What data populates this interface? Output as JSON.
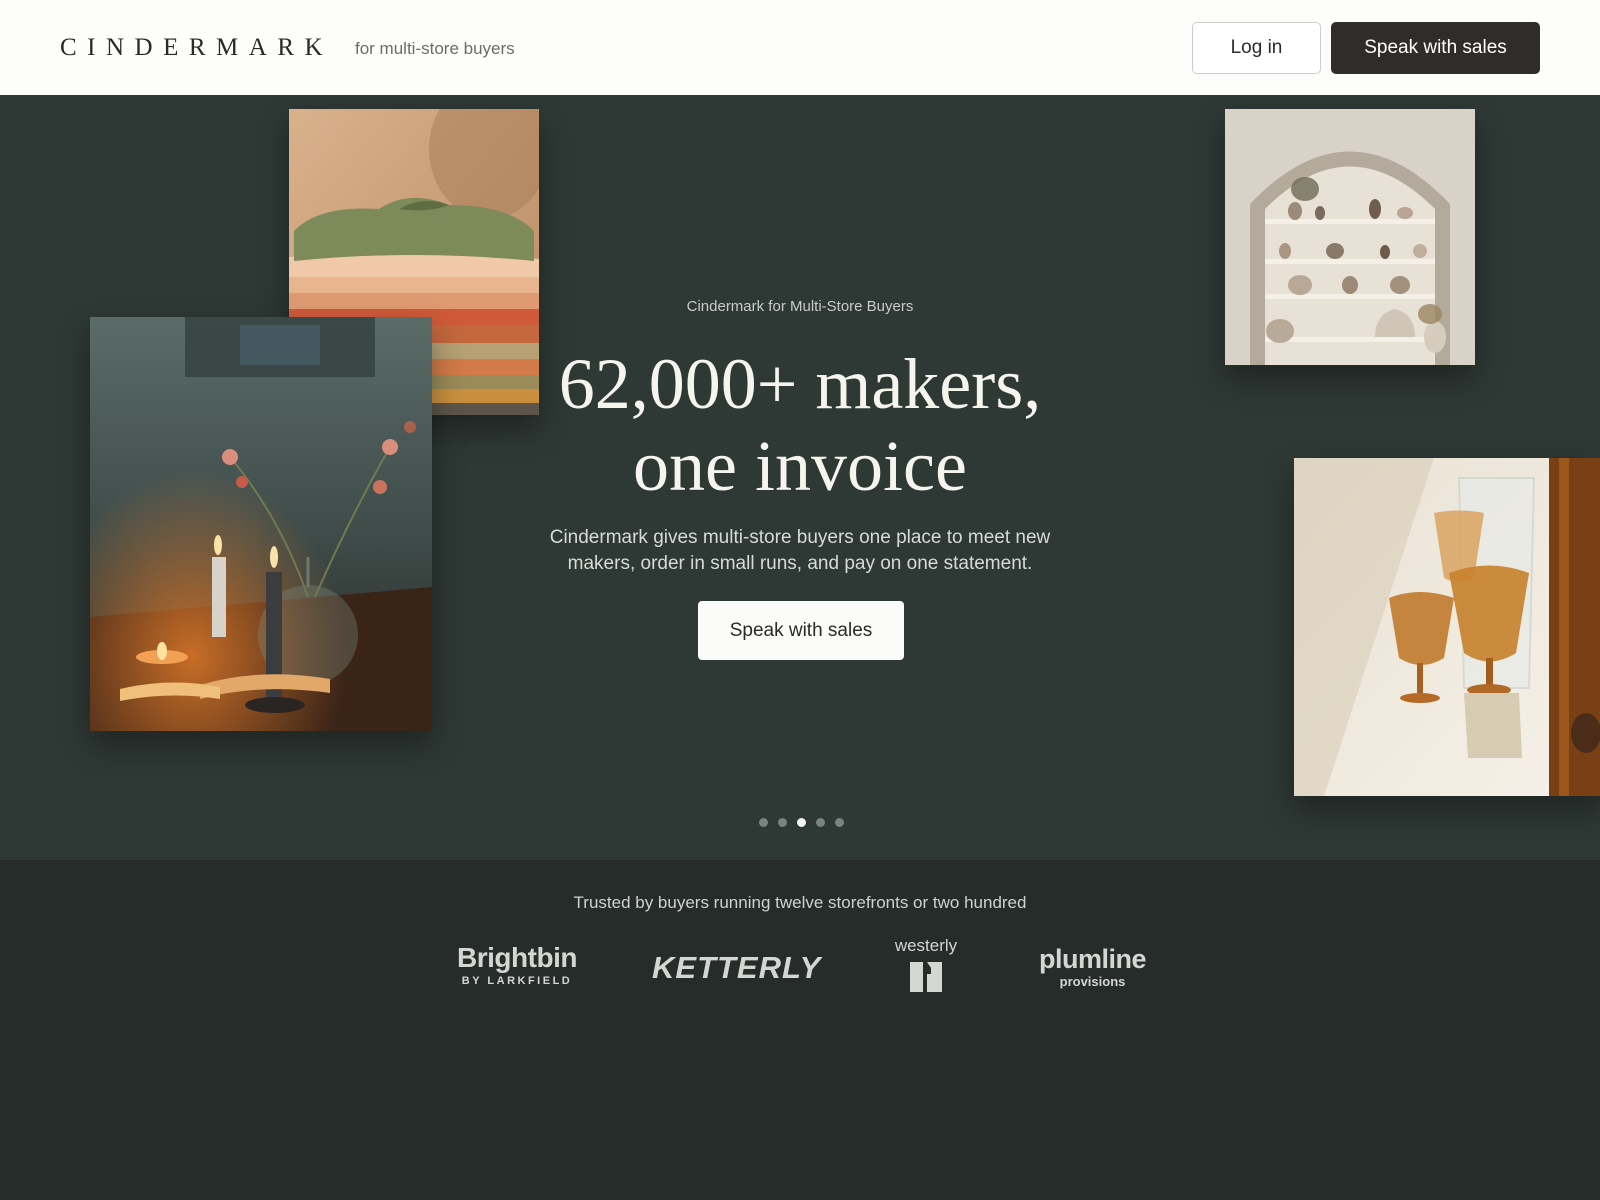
{
  "header": {
    "logo": "CINDERMARK",
    "tagline": "for multi-store buyers",
    "login_label": "Log in",
    "sales_label": "Speak with sales"
  },
  "hero": {
    "eyebrow": "Cindermark for Multi-Store Buyers",
    "headline_line1": "62,000+ makers,",
    "headline_line2": "one invoice",
    "subcopy": "Cindermark gives multi-store buyers one place to meet new makers, order in small runs, and pay on one statement.",
    "cta_label": "Speak with sales",
    "carousel": {
      "total": 5,
      "active_index": 2
    }
  },
  "trusted": {
    "caption": "Trusted by buyers running twelve storefronts or two hundred",
    "logos": [
      {
        "main": "Brightbin",
        "sub": "BY LARKFIELD"
      },
      {
        "main": "KETTERLY"
      },
      {
        "main": "westerly"
      },
      {
        "main": "plumline",
        "sub": "provisions"
      }
    ]
  },
  "colors": {
    "header_bg": "#fdfdfc",
    "hero_bg": "#2e3834",
    "page_bg": "#252c29",
    "dark_button": "#2f2c2a"
  }
}
